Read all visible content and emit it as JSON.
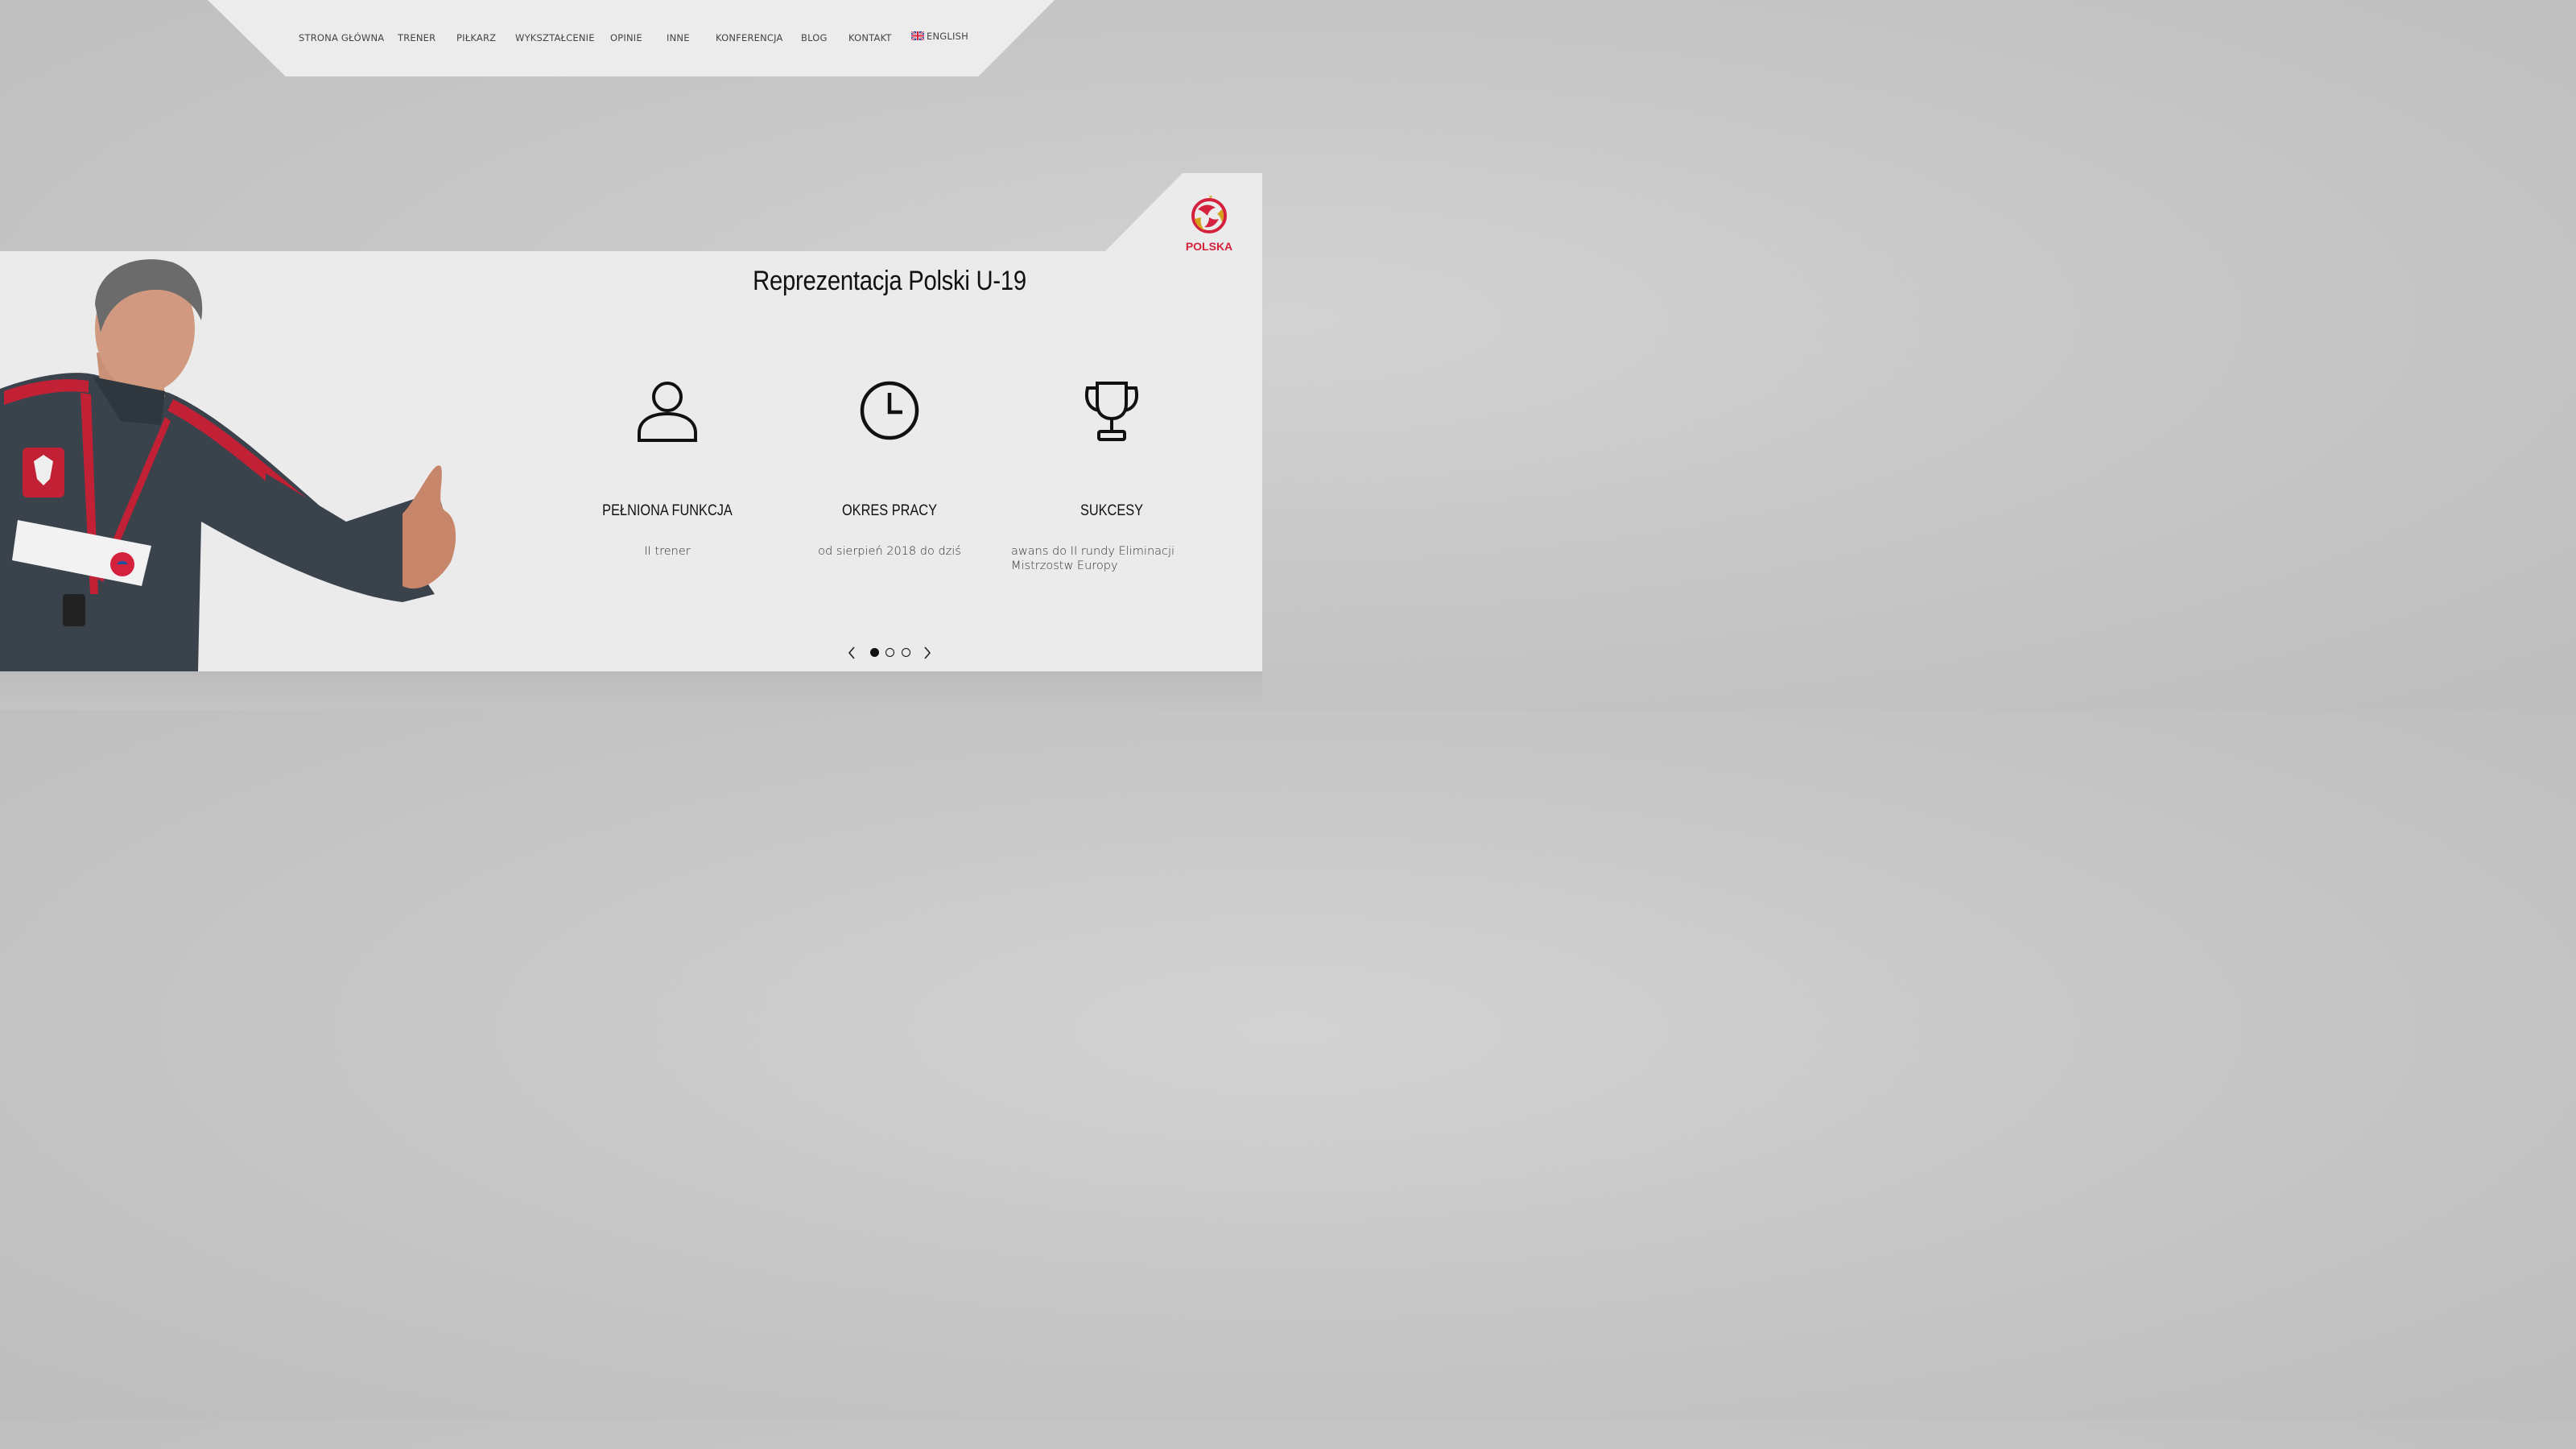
{
  "nav": {
    "items": [
      {
        "label": "STRONA GŁÓWNA"
      },
      {
        "label": "TRENER"
      },
      {
        "label": "PIŁKARZ"
      },
      {
        "label": "WYKSZTAŁCENIE"
      },
      {
        "label": "OPINIE"
      },
      {
        "label": "INNE"
      },
      {
        "label": "KONFERENCJA"
      },
      {
        "label": "BLOG"
      },
      {
        "label": "KONTAKT"
      },
      {
        "label": "ENGLISH",
        "icon": "uk-flag-icon"
      }
    ]
  },
  "logo": {
    "text": "POLSKA"
  },
  "section": {
    "title": "Reprezentacja Polski U-19",
    "columns": [
      {
        "icon": "user-icon",
        "title": "PEŁNIONA FUNKCJA",
        "text": "II trener"
      },
      {
        "icon": "clock-icon",
        "title": "OKRES PRACY",
        "text": "od sierpień 2018 do dziś"
      },
      {
        "icon": "trophy-icon",
        "title": "SUKCESY",
        "text": "awans do II rundy Eliminacji Mistrzostw Europy"
      }
    ]
  },
  "slider": {
    "slides": 3,
    "active_index": 0
  },
  "colors": {
    "accent_red": "#d4213d",
    "text_dark": "#111111",
    "panel": "#ebebeb"
  }
}
